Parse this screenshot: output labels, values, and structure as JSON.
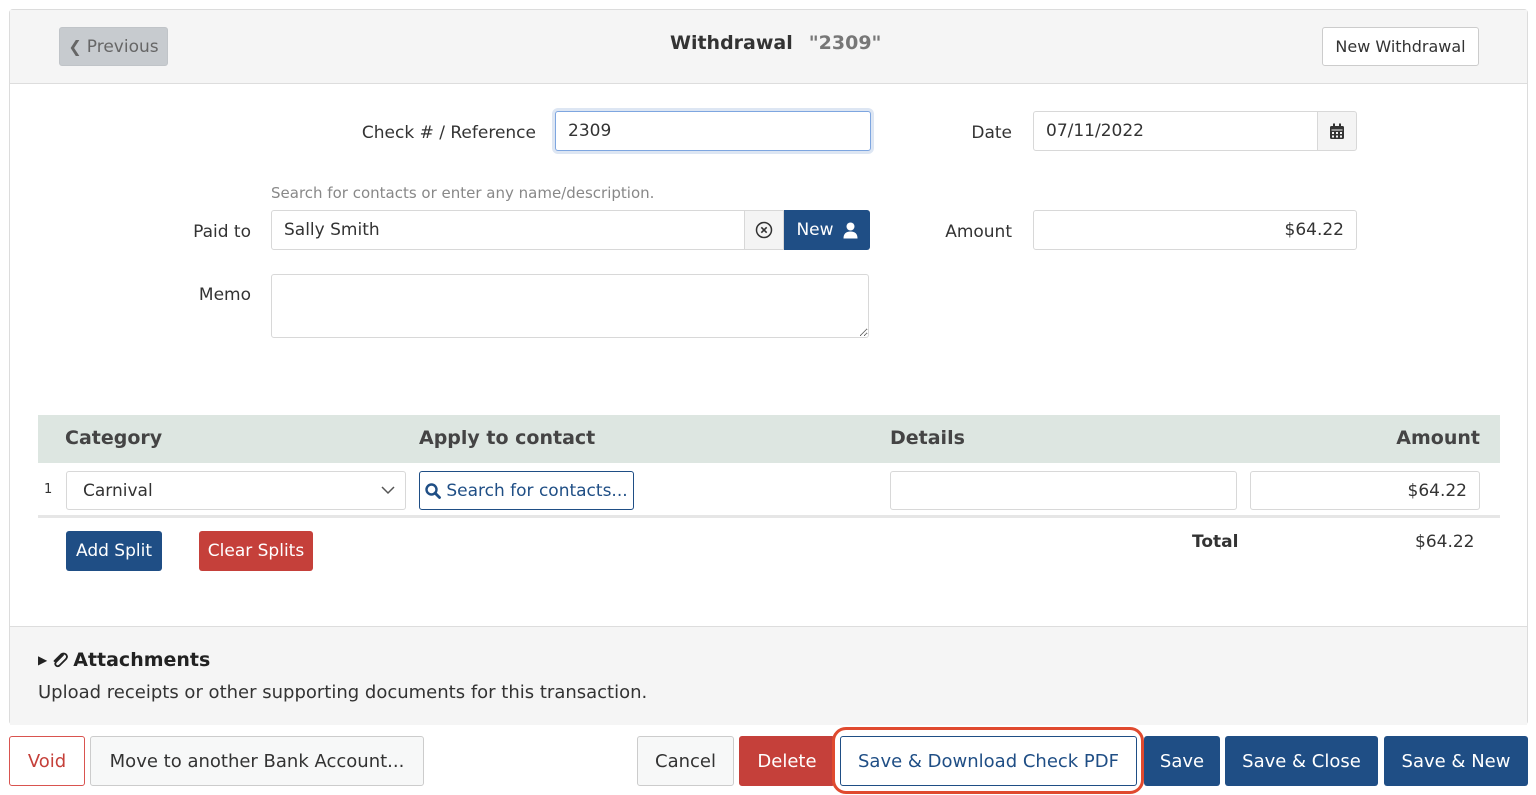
{
  "header": {
    "previous_label": "Previous",
    "title": "Withdrawal",
    "reference_display": "\"2309\"",
    "new_withdrawal_label": "New Withdrawal"
  },
  "form": {
    "check_ref_label": "Check # / Reference",
    "check_ref_value": "2309",
    "date_label": "Date",
    "date_value": "07/11/2022",
    "paid_to_help": "Search for contacts or enter any name/description.",
    "paid_to_label": "Paid to",
    "paid_to_value": "Sally Smith",
    "new_contact_label": "New",
    "amount_label": "Amount",
    "amount_value": "$64.22",
    "memo_label": "Memo",
    "memo_value": ""
  },
  "splits": {
    "columns": [
      "Category",
      "Apply to contact",
      "Details",
      "Amount"
    ],
    "rows": [
      {
        "num": "1",
        "category": "Carnival",
        "contact_button": "Search for contacts...",
        "details": "",
        "amount": "$64.22"
      }
    ],
    "add_split_label": "Add Split",
    "clear_splits_label": "Clear Splits",
    "total_label": "Total",
    "total_value": "$64.22"
  },
  "attachments": {
    "title": "Attachments",
    "description": "Upload receipts or other supporting documents for this transaction."
  },
  "footer": {
    "void": "Void",
    "move": "Move to another Bank Account...",
    "cancel": "Cancel",
    "delete": "Delete",
    "save_pdf": "Save & Download Check PDF",
    "save": "Save",
    "save_close": "Save & Close",
    "save_new": "Save & New"
  },
  "colors": {
    "primary": "#1f4e85",
    "danger": "#c5403a",
    "highlight": "#e04a2f",
    "table_header_bg": "#dde6e1"
  }
}
